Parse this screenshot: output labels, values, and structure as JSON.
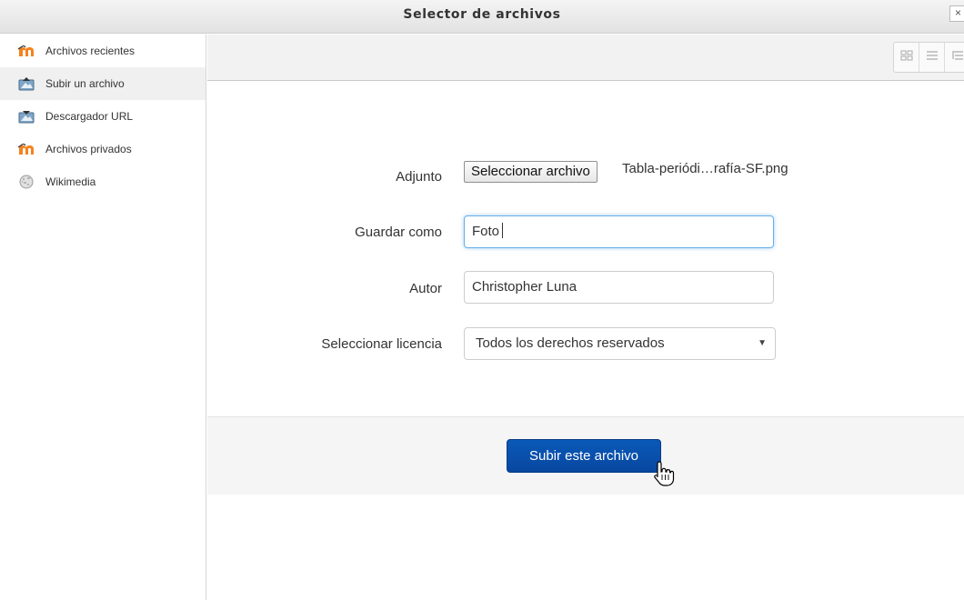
{
  "dialog": {
    "title": "Selector de archivos",
    "close_label": "×"
  },
  "sidebar": {
    "items": [
      {
        "label": "Archivos recientes",
        "icon": "moodle-icon"
      },
      {
        "label": "Subir un archivo",
        "icon": "upload-icon",
        "active": true
      },
      {
        "label": "Descargador URL",
        "icon": "url-download-icon"
      },
      {
        "label": "Archivos privados",
        "icon": "moodle-icon"
      },
      {
        "label": "Wikimedia",
        "icon": "wikimedia-icon"
      }
    ]
  },
  "toolbar": {
    "view_buttons": [
      "icons-view-icon",
      "list-view-icon",
      "tree-view-icon"
    ]
  },
  "form": {
    "attachment_label": "Adjunto",
    "choose_file_button": "Seleccionar archivo",
    "chosen_file": "Tabla-periódi…rafía-SF.png",
    "save_as_label": "Guardar como",
    "save_as_value": "Foto",
    "author_label": "Autor",
    "author_value": "Christopher Luna",
    "license_label": "Seleccionar licencia",
    "license_value": "Todos los derechos reservados"
  },
  "footer": {
    "upload_button": "Subir este archivo"
  },
  "colors": {
    "primary_button": "#0a59b8",
    "focus_border": "#66afe9",
    "sidebar_active": "#f0f0f0"
  }
}
